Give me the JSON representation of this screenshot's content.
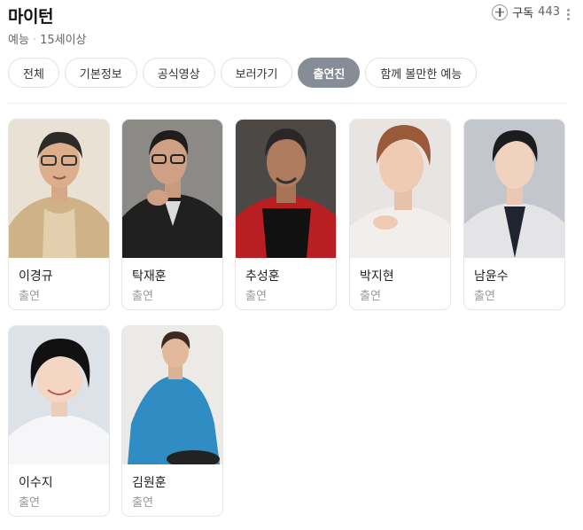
{
  "header": {
    "title": "마이턴",
    "genre": "예능",
    "rating": "15세이상",
    "subscribe_label": "구독",
    "subscribe_count": "443"
  },
  "tabs": [
    {
      "label": "전체",
      "active": false
    },
    {
      "label": "기본정보",
      "active": false
    },
    {
      "label": "공식영상",
      "active": false
    },
    {
      "label": "보러가기",
      "active": false
    },
    {
      "label": "출연진",
      "active": true
    },
    {
      "label": "함께 볼만한 예능",
      "active": false
    }
  ],
  "cast": [
    {
      "name": "이경규",
      "role": "출연"
    },
    {
      "name": "탁재훈",
      "role": "출연"
    },
    {
      "name": "추성훈",
      "role": "출연"
    },
    {
      "name": "박지현",
      "role": "출연"
    },
    {
      "name": "남윤수",
      "role": "출연"
    },
    {
      "name": "이수지",
      "role": "출연"
    },
    {
      "name": "김원훈",
      "role": "출연"
    }
  ],
  "colors": {
    "active_tab": "#878d96",
    "border": "#e6e6e6"
  },
  "icons": [
    "plus-circle-icon",
    "more-vertical-icon"
  ]
}
